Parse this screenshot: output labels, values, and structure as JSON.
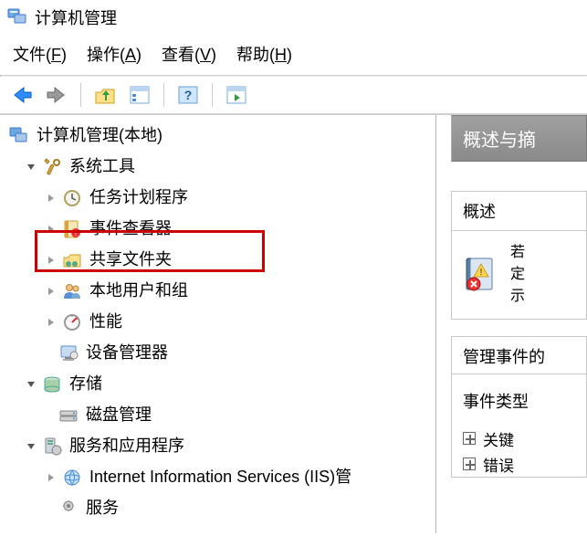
{
  "window": {
    "title": "计算机管理"
  },
  "menubar": {
    "file": {
      "label": "文件",
      "accel": "F"
    },
    "action": {
      "label": "操作",
      "accel": "A"
    },
    "view": {
      "label": "查看",
      "accel": "V"
    },
    "help": {
      "label": "帮助",
      "accel": "H"
    }
  },
  "tree": {
    "root": "计算机管理(本地)",
    "system_tools": "系统工具",
    "task_scheduler": "任务计划程序",
    "event_viewer": "事件查看器",
    "shared_folders": "共享文件夹",
    "local_users": "本地用户和组",
    "performance": "性能",
    "device_manager": "设备管理器",
    "storage": "存储",
    "disk_mgmt": "磁盘管理",
    "services_apps": "服务和应用程序",
    "iis": "Internet Information Services (IIS)管",
    "services_row": "服务"
  },
  "right": {
    "header": "概述与摘",
    "section_overview": "概述",
    "overview_line1": "若",
    "overview_line2": "定",
    "overview_line3": "示",
    "manage_events": "管理事件的",
    "event_types": "事件类型",
    "type_critical": "关键",
    "type_error": "错误"
  }
}
